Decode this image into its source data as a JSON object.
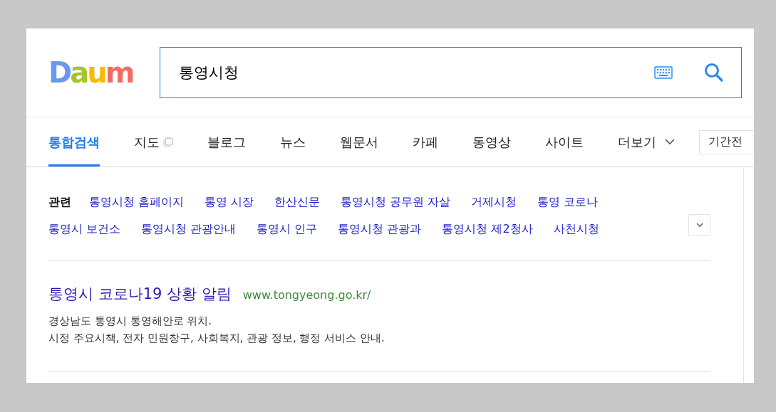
{
  "logo": "Daum",
  "search": {
    "value": "통영시청"
  },
  "tabs": [
    {
      "label": "통합검색",
      "selected": true,
      "external": false,
      "dropdown": false
    },
    {
      "label": "지도",
      "selected": false,
      "external": true,
      "dropdown": false
    },
    {
      "label": "블로그",
      "selected": false,
      "external": false,
      "dropdown": false
    },
    {
      "label": "뉴스",
      "selected": false,
      "external": false,
      "dropdown": false
    },
    {
      "label": "웹문서",
      "selected": false,
      "external": false,
      "dropdown": false
    },
    {
      "label": "카페",
      "selected": false,
      "external": false,
      "dropdown": false
    },
    {
      "label": "동영상",
      "selected": false,
      "external": false,
      "dropdown": false
    },
    {
      "label": "사이트",
      "selected": false,
      "external": false,
      "dropdown": false
    },
    {
      "label": "더보기",
      "selected": false,
      "external": false,
      "dropdown": true
    }
  ],
  "period_filter": "기간전",
  "related": {
    "label": "관련",
    "items": [
      [
        "통영시청 홈페이지",
        "통영 시장",
        "한산신문",
        "통영시청 공무원 자살",
        "거제시청",
        "통영 코로나"
      ],
      [
        "통영시 보건소",
        "통영시청 관광안내",
        "통영시 인구",
        "통영시청 관광과",
        "통영시청 제2청사",
        "사천시청"
      ]
    ]
  },
  "results": [
    {
      "title": "통영시 코로나19 상황 알림",
      "url": "www.tongyeong.go.kr/",
      "lines": [
        "경상남도 통영시 통영해안로 위치.",
        "시정 주요시책, 전자 민원창구, 사회복지, 관광 정보, 행정 서비스 안내."
      ]
    }
  ]
}
